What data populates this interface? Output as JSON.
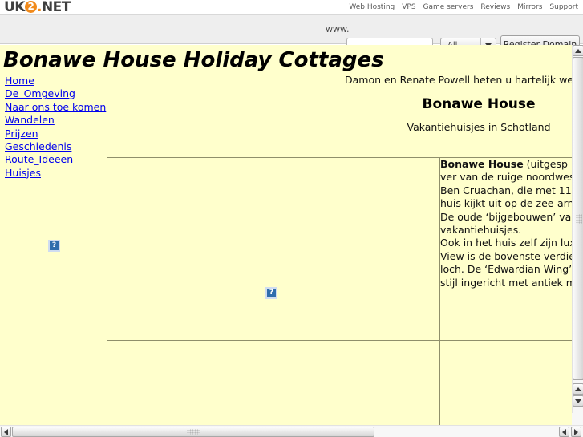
{
  "uk2_bar": {
    "logo": {
      "prefix": "UK",
      "glyph": "2",
      "dot": ".",
      "suffix": "NET"
    },
    "nav": [
      {
        "label": "Web Hosting"
      },
      {
        "label": "VPS"
      },
      {
        "label": "Game servers"
      },
      {
        "label": "Reviews"
      },
      {
        "label": "Mirrors"
      },
      {
        "label": "Support"
      }
    ]
  },
  "search": {
    "www_label": "www.",
    "domain_value": "",
    "domain_placeholder": "",
    "tld_selected": "All",
    "tld_options": [
      "All"
    ],
    "register_label": "Register Domain"
  },
  "page": {
    "title": "Bonawe House Holiday Cottages",
    "sidebar": [
      {
        "label": "Home"
      },
      {
        "label": "De_Omgeving"
      },
      {
        "label": "Naar ons toe komen"
      },
      {
        "label": "Wandelen"
      },
      {
        "label": "Prijzen"
      },
      {
        "label": "Geschiedenis"
      },
      {
        "label": "Route_Ideeen"
      },
      {
        "label": "Huisjes"
      }
    ],
    "sidebar_image_alt": "?",
    "welcome_line": "Damon en Renate Powell heten u hartelijk we",
    "bonawe_heading": "Bonawe House",
    "bonawe_sub": "Vakantiehuisjes in Schotland",
    "photo_image_alt": "?",
    "cottage_text": {
      "lead": "Bonawe House",
      "lines": [
        " (uitgesp",
        "ver van de ruige noordwes",
        "Ben Cruachan, die met 11",
        "huis kijkt uit op de zee-arn",
        "De oude ‘bijgebouwen’ va",
        "vakantiehuisjes.",
        "Ook in het huis zelf zijn lux",
        "View is de bovenste verdie",
        "loch. De ‘Edwardian Wing’",
        "stijl ingericht met antiek m"
      ]
    }
  },
  "colors": {
    "page_background": "#ffffcc",
    "link": "#0000ee",
    "table_border": "#8f8f6b",
    "logo_accent": "#f18a1b",
    "chrome": "#eeeeee"
  }
}
